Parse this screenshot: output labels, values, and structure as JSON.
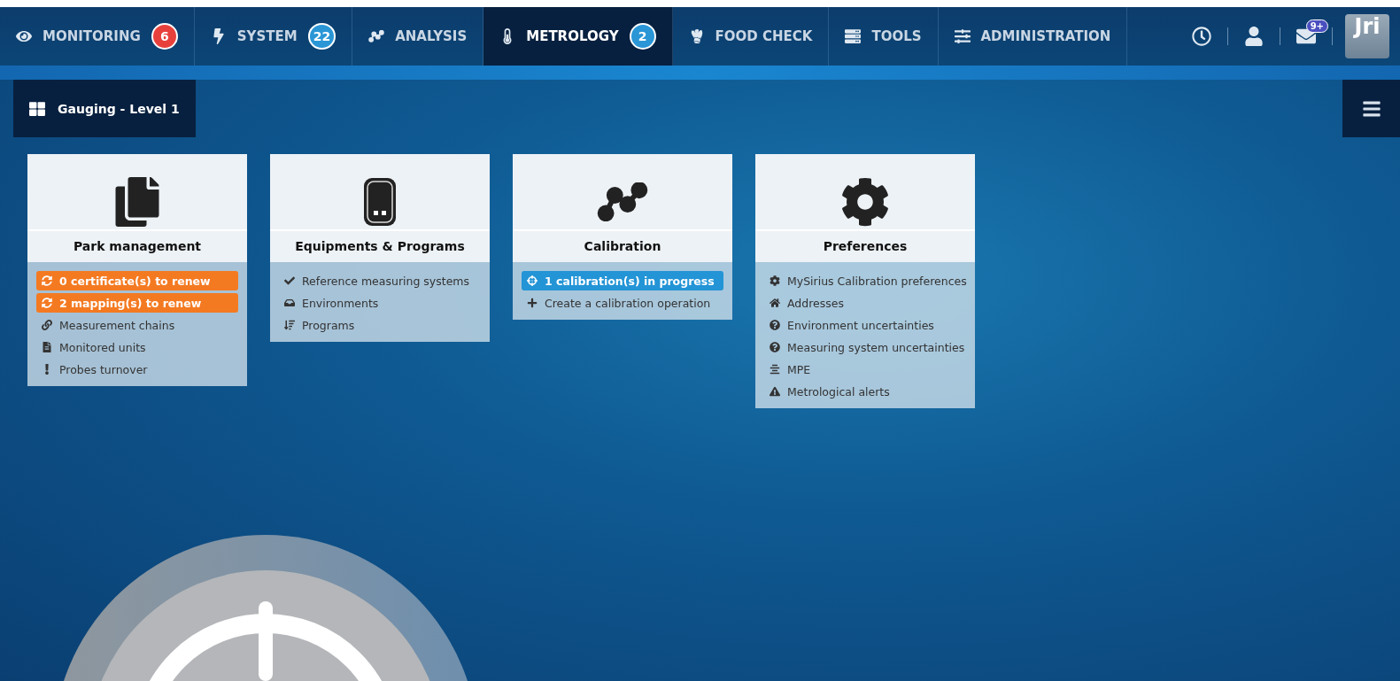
{
  "nav": {
    "tabs": [
      {
        "label": "MONITORING",
        "selected": false,
        "badge": {
          "text": "6",
          "color": "#e8413c"
        }
      },
      {
        "label": "SYSTEM",
        "selected": false,
        "badge": {
          "text": "22",
          "color": "#2a96d6"
        }
      },
      {
        "label": "ANALYSIS",
        "selected": false
      },
      {
        "label": "METROLOGY",
        "selected": true,
        "badge": {
          "text": "2",
          "color": "#2a96d6"
        }
      },
      {
        "label": "FOOD CHECK",
        "selected": false
      },
      {
        "label": "TOOLS",
        "selected": false
      },
      {
        "label": "ADMINISTRATION",
        "selected": false
      }
    ],
    "mail_badge": "9+",
    "logo": "Jri"
  },
  "page_title": "Gauging - Level 1",
  "cards": [
    {
      "title": "Park management",
      "items": [
        {
          "kind": "alert",
          "label": "0 certificate(s) to renew"
        },
        {
          "kind": "alert",
          "label": "2 mapping(s) to renew"
        },
        {
          "kind": "link",
          "label": "Measurement chains"
        },
        {
          "kind": "link",
          "label": "Monitored units"
        },
        {
          "kind": "link",
          "label": "Probes turnover"
        }
      ]
    },
    {
      "title": "Equipments & Programs",
      "items": [
        {
          "kind": "link",
          "label": "Reference measuring systems"
        },
        {
          "kind": "link",
          "label": "Environments"
        },
        {
          "kind": "link",
          "label": "Programs"
        }
      ]
    },
    {
      "title": "Calibration",
      "items": [
        {
          "kind": "active",
          "label": "1 calibration(s) in progress"
        },
        {
          "kind": "link",
          "label": "Create a calibration operation"
        }
      ]
    },
    {
      "title": "Preferences",
      "items": [
        {
          "kind": "link",
          "label": "MySirius Calibration preferences"
        },
        {
          "kind": "link",
          "label": "Addresses"
        },
        {
          "kind": "link",
          "label": "Environment uncertainties"
        },
        {
          "kind": "link",
          "label": "Measuring system uncertainties"
        },
        {
          "kind": "link",
          "label": "MPE"
        },
        {
          "kind": "link",
          "label": "Metrological alerts"
        }
      ]
    }
  ]
}
